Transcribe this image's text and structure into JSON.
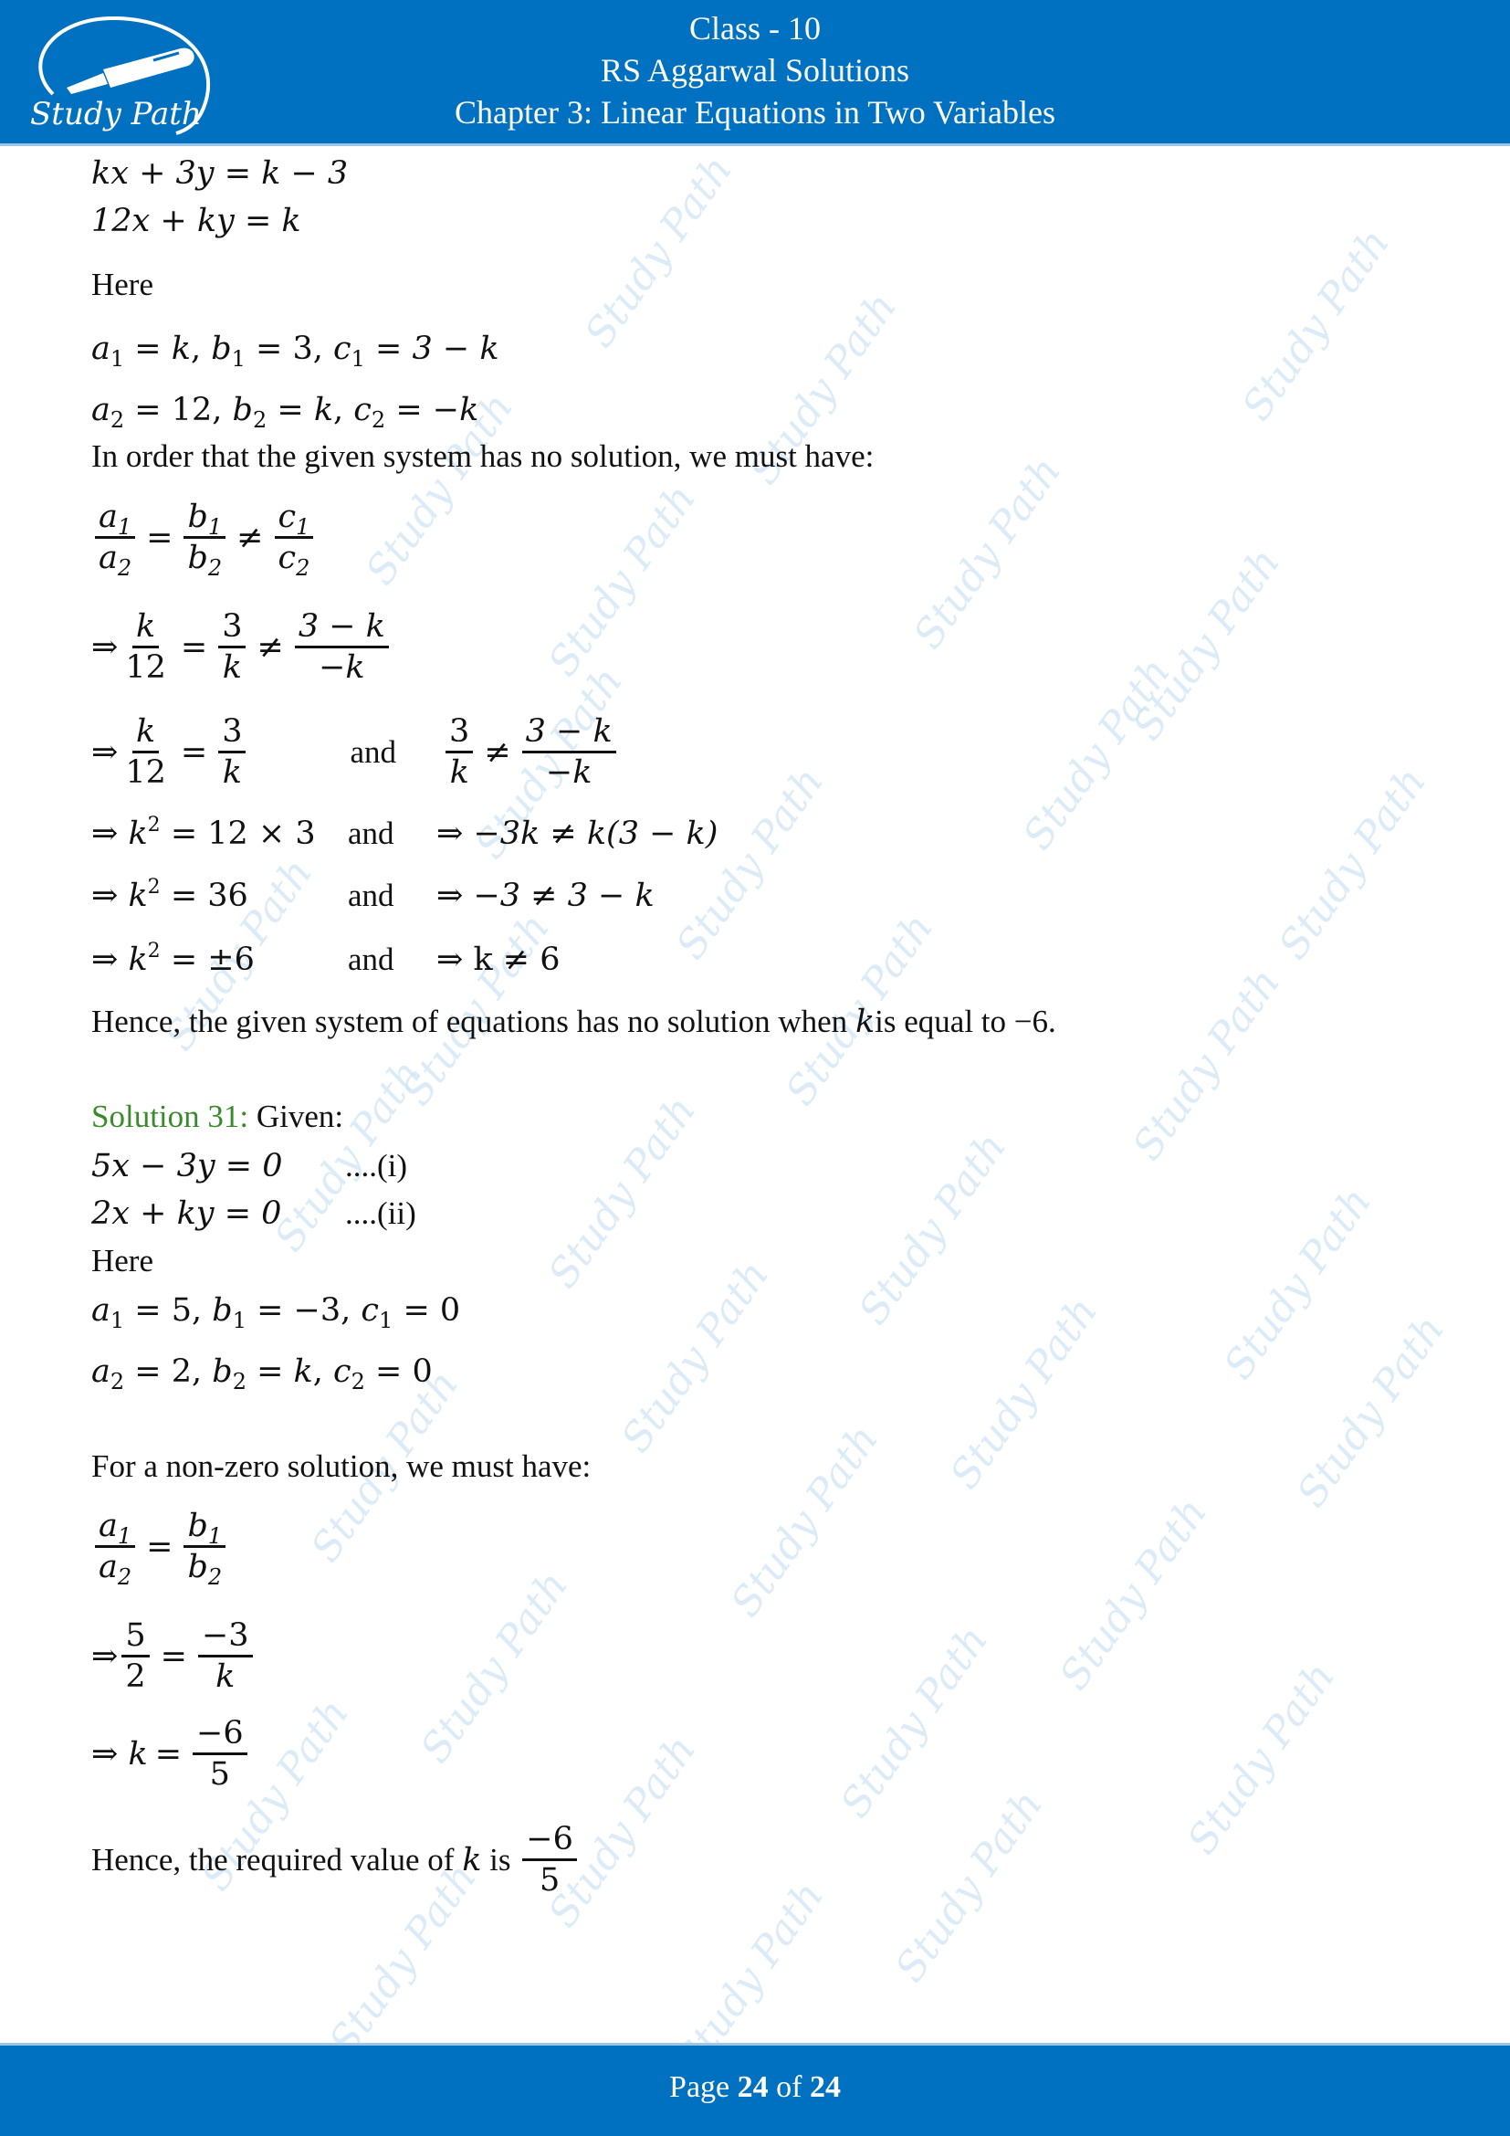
{
  "header": {
    "logo_text": "Study Path",
    "class_line": "Class - 10",
    "book_line": "RS Aggarwal Solutions",
    "chapter_line": "Chapter 3: Linear Equations in Two Variables"
  },
  "watermark_text": "Study Path",
  "solution30_continued": {
    "eq1": "kx + 3y = k − 3",
    "eq2": "12x + ky = k",
    "here": "Here",
    "coeffs1": {
      "a": "k",
      "b": "3",
      "c": "3 − k"
    },
    "coeffs2": {
      "a": "12",
      "b": "k",
      "c": "−k"
    },
    "condition_text": "In order that the given system has no solution, we must have:",
    "step1": {
      "n1": "k",
      "d1": "12",
      "n2": "3",
      "d2": "k",
      "n3": "3 − k",
      "d3": "−k"
    },
    "step2": {
      "left_n1": "k",
      "left_d1": "12",
      "left_n2": "3",
      "left_d2": "k",
      "and": "and",
      "right_n1": "3",
      "right_d1": "k",
      "right_n2": "3 − k",
      "right_d2": "−k"
    },
    "step3": {
      "left": "= 12 × 3",
      "and": "and",
      "right": "⇒ −3k ≠ k(3 − k)"
    },
    "step4": {
      "left": "= 36",
      "and": "and",
      "right": "⇒ −3 ≠ 3 − k"
    },
    "step5": {
      "left": "= ±6",
      "and": "and",
      "right": "⇒ k ≠ 6"
    },
    "conclusion_pre": "Hence, the given system of equations has no solution when ",
    "conclusion_var": "k",
    "conclusion_post": "is equal to −6."
  },
  "solution31": {
    "label": "Solution 31:",
    "given": " Given:",
    "eq1": "5x − 3y = 0",
    "eq1_tag": "....(i)",
    "eq2": "2x + ky = 0",
    "eq2_tag": "....(ii)",
    "here": "Here",
    "coeffs1": {
      "a": "5",
      "b": "−3",
      "c": "0"
    },
    "coeffs2": {
      "a": "2",
      "b": "k",
      "c": "0"
    },
    "condition_text": "For a non-zero solution, we must have:",
    "step1": {
      "n1": "5",
      "d1": "2",
      "n2": "−3",
      "d2": "k"
    },
    "step2": {
      "n": "−6",
      "d": "5"
    },
    "conclusion_pre": "Hence, the required value of ",
    "conclusion_var": "k",
    "conclusion_mid": " is ",
    "answer": {
      "n": "−6",
      "d": "5"
    }
  },
  "footer": {
    "page_word": "Page ",
    "current_page": "24",
    "of_word": " of ",
    "total_pages": "24"
  }
}
